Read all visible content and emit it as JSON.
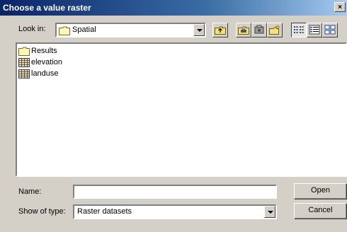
{
  "window": {
    "title": "Choose a value raster",
    "close_glyph": "×"
  },
  "lookin": {
    "label": "Look in:",
    "value": "Spatial",
    "icon": "folder-icon"
  },
  "toolbar": {
    "buttons": [
      {
        "name": "up-one-level-button",
        "icon": "up-folder-icon"
      },
      {
        "name": "connect-folder-button",
        "icon": "connect-folder-icon"
      },
      {
        "name": "disconnect-folder-button",
        "icon": "disconnect-folder-icon"
      },
      {
        "name": "new-folder-button",
        "icon": "new-folder-icon"
      },
      {
        "name": "list-view-button",
        "icon": "list-view-icon",
        "pressed": true
      },
      {
        "name": "details-view-button",
        "icon": "details-view-icon"
      },
      {
        "name": "thumbnails-view-button",
        "icon": "thumbnails-view-icon"
      }
    ]
  },
  "files": [
    {
      "label": "Results",
      "icon": "folder-icon"
    },
    {
      "label": "elevation",
      "icon": "raster-grid-icon"
    },
    {
      "label": "landuse",
      "icon": "raster-grid-icon"
    }
  ],
  "name_field": {
    "label": "Name:",
    "value": ""
  },
  "type_field": {
    "label": "Show of type:",
    "value": "Raster datasets"
  },
  "buttons": {
    "open": "Open",
    "cancel": "Cancel"
  }
}
